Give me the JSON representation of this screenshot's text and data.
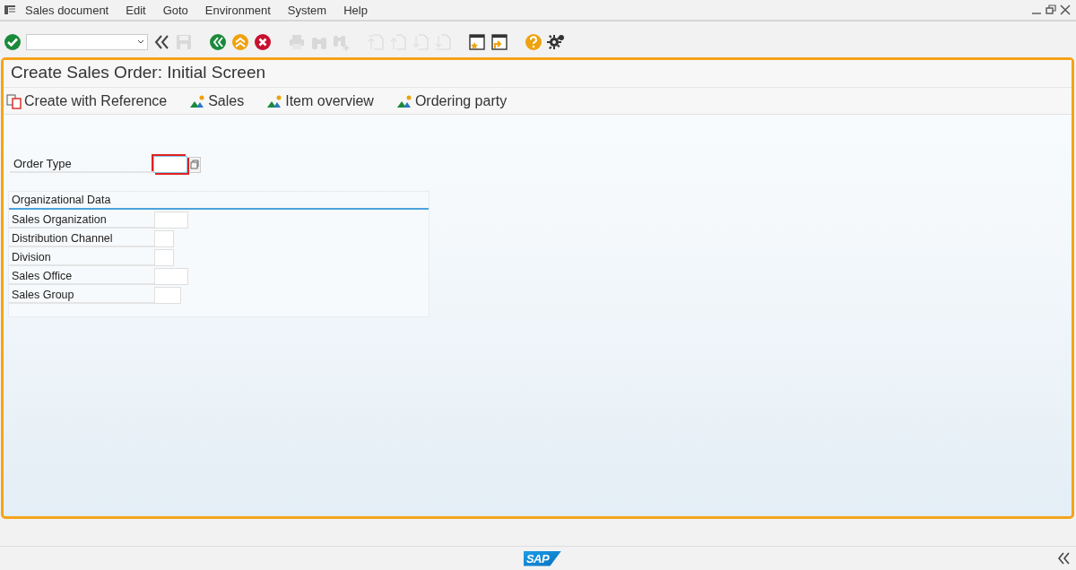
{
  "menu": [
    "Sales document",
    "Edit",
    "Goto",
    "Environment",
    "System",
    "Help"
  ],
  "toolbar": {
    "buttons": [
      {
        "kind": "enter",
        "disabled": false
      },
      {
        "kind": "back-arrows",
        "disabled": false
      },
      {
        "kind": "save",
        "disabled": true
      },
      {
        "kind": "back",
        "disabled": false
      },
      {
        "kind": "exit",
        "disabled": false
      },
      {
        "kind": "cancel",
        "disabled": false
      },
      {
        "kind": "print",
        "disabled": true
      },
      {
        "kind": "find",
        "disabled": true
      },
      {
        "kind": "find-next",
        "disabled": true
      },
      {
        "kind": "first-page",
        "disabled": true
      },
      {
        "kind": "prev-page",
        "disabled": true
      },
      {
        "kind": "next-page",
        "disabled": true
      },
      {
        "kind": "last-page",
        "disabled": true
      },
      {
        "kind": "bookmark-window",
        "disabled": false
      },
      {
        "kind": "new-window",
        "disabled": false
      },
      {
        "kind": "help",
        "disabled": false
      },
      {
        "kind": "settings",
        "disabled": false
      }
    ]
  },
  "screen": {
    "title": "Create Sales Order: Initial Screen",
    "actions": [
      {
        "kind": "reference",
        "label": "Create with Reference"
      },
      {
        "kind": "overview",
        "label": "Sales"
      },
      {
        "kind": "overview",
        "label": "Item overview"
      },
      {
        "kind": "overview",
        "label": "Ordering party"
      }
    ],
    "order_type": {
      "label": "Order Type",
      "focused": true
    },
    "org_data": {
      "title": "Organizational Data",
      "fields": [
        {
          "label": "Sales Organization"
        },
        {
          "label": "Distribution Channel"
        },
        {
          "label": "Division"
        },
        {
          "label": "Sales Office"
        },
        {
          "label": "Sales Group"
        }
      ]
    }
  },
  "status_bar": {
    "logo": "SAP"
  }
}
